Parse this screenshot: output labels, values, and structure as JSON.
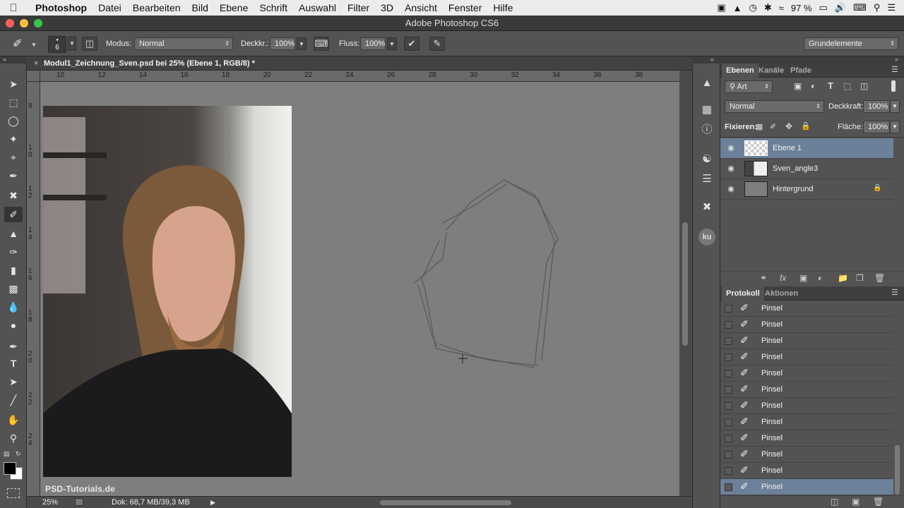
{
  "menubar": {
    "app": "Photoshop",
    "items": [
      "Datei",
      "Bearbeiten",
      "Bild",
      "Ebene",
      "Schrift",
      "Auswahl",
      "Filter",
      "3D",
      "Ansicht",
      "Fenster",
      "Hilfe"
    ],
    "battery": "97 %"
  },
  "window": {
    "title": "Adobe Photoshop CS6"
  },
  "options": {
    "brush_size": "6",
    "mode_label": "Modus:",
    "mode_value": "Normal",
    "opacity_label": "Deckkr.:",
    "opacity_value": "100%",
    "flow_label": "Fluss:",
    "flow_value": "100%",
    "workspace": "Grundelemente"
  },
  "document": {
    "tab_title": "Modul1_Zeichnung_Sven.psd bei 25% (Ebene 1, RGB/8) *",
    "ruler_top": [
      "10",
      "12",
      "14",
      "16",
      "18",
      "20",
      "22",
      "24",
      "26",
      "28",
      "30",
      "32",
      "34",
      "36",
      "38"
    ],
    "ruler_left": [
      "8",
      "1 0",
      "1 2",
      "1 4",
      "1 6",
      "1 8",
      "2 0",
      "2 2",
      "2 4"
    ],
    "zoom": "25%",
    "doc_info": "Dok: 68,7 MB/39,3 MB",
    "watermark": "PSD-Tutorials.de"
  },
  "layers_panel": {
    "tabs": [
      "Ebenen",
      "Kanäle",
      "Pfade"
    ],
    "filter_label": "Art",
    "blend_mode": "Normal",
    "opacity_label": "Deckkraft:",
    "opacity_value": "100%",
    "lock_label": "Fixieren:",
    "fill_label": "Fläche:",
    "fill_value": "100%",
    "layers": [
      {
        "name": "Ebene 1",
        "selected": true
      },
      {
        "name": "Sven_angle3",
        "selected": false
      },
      {
        "name": "Hintergrund",
        "selected": false,
        "locked": true
      }
    ]
  },
  "history_panel": {
    "tabs": [
      "Protokoll",
      "Aktionen"
    ],
    "items": [
      "Pinsel",
      "Pinsel",
      "Pinsel",
      "Pinsel",
      "Pinsel",
      "Pinsel",
      "Pinsel",
      "Pinsel",
      "Pinsel",
      "Pinsel",
      "Pinsel",
      "Pinsel"
    ],
    "selected_index": 11
  },
  "colors": {
    "selection": "#6d8099",
    "panel": "#535353",
    "canvas": "#7e7e7e"
  }
}
